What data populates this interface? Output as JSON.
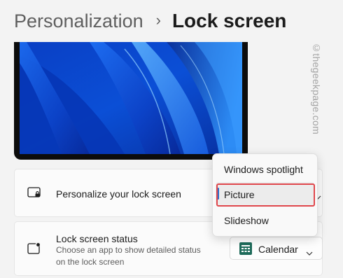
{
  "breadcrumb": {
    "parent": "Personalization",
    "separator": "›",
    "current": "Lock screen"
  },
  "watermark": "©thegeekpage.com",
  "personalize_card": {
    "title": "Personalize your lock screen",
    "icon": "lock-screen-image-icon"
  },
  "status_card": {
    "title": "Lock screen status",
    "description": "Choose an app to show detailed status on the lock screen",
    "icon": "lock-screen-status-icon",
    "select_value": "Calendar",
    "select_icon": "calendar-icon"
  },
  "dropdown": {
    "options": [
      "Windows spotlight",
      "Picture",
      "Slideshow"
    ],
    "selected": "Picture"
  },
  "colors": {
    "accent": "#2f6fca",
    "highlight": "#e0474c",
    "calendar_icon": "#1e6b5a"
  }
}
